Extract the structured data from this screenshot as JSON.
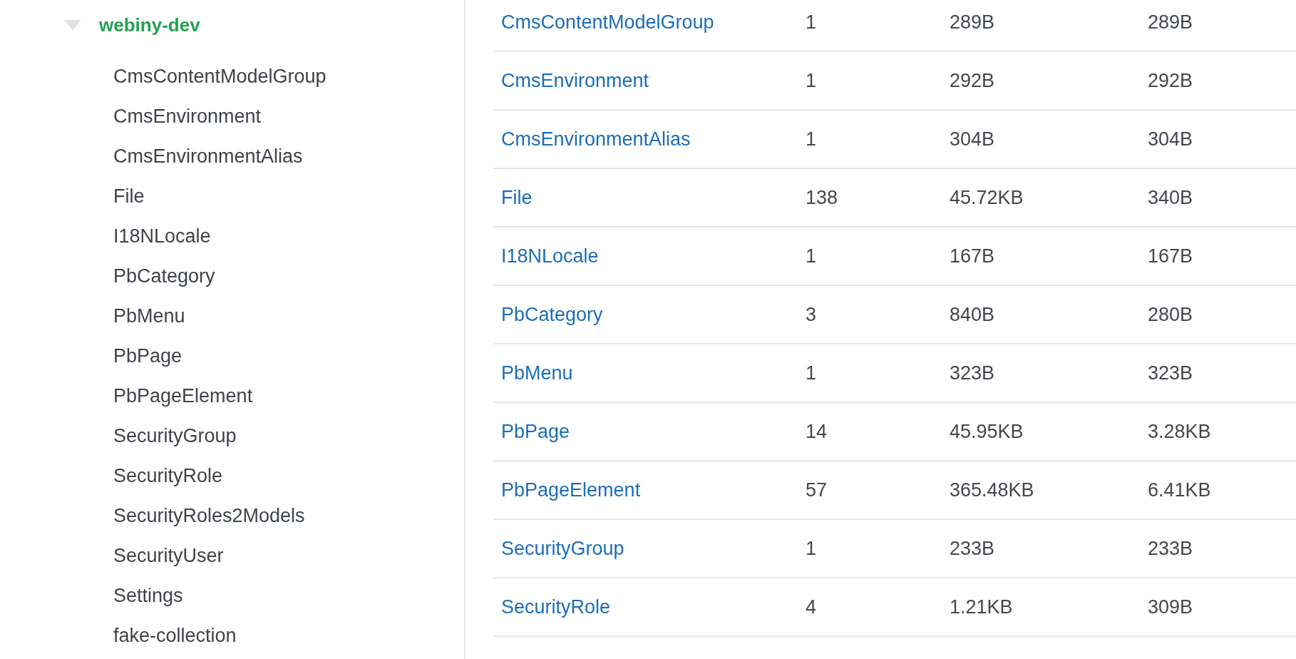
{
  "sidebar": {
    "database": {
      "name": "webiny-dev",
      "expanded": true
    },
    "collections": [
      "CmsContentModelGroup",
      "CmsEnvironment",
      "CmsEnvironmentAlias",
      "File",
      "I18NLocale",
      "PbCategory",
      "PbMenu",
      "PbPage",
      "PbPageElement",
      "SecurityGroup",
      "SecurityRole",
      "SecurityRoles2Models",
      "SecurityUser",
      "Settings",
      "fake-collection"
    ]
  },
  "table": {
    "rows": [
      {
        "collection": "CmsContentModelGroup",
        "cells": [
          "1",
          "289B",
          "289B"
        ]
      },
      {
        "collection": "CmsEnvironment",
        "cells": [
          "1",
          "292B",
          "292B"
        ]
      },
      {
        "collection": "CmsEnvironmentAlias",
        "cells": [
          "1",
          "304B",
          "304B"
        ]
      },
      {
        "collection": "File",
        "cells": [
          "138",
          "45.72KB",
          "340B"
        ]
      },
      {
        "collection": "I18NLocale",
        "cells": [
          "1",
          "167B",
          "167B"
        ]
      },
      {
        "collection": "PbCategory",
        "cells": [
          "3",
          "840B",
          "280B"
        ]
      },
      {
        "collection": "PbMenu",
        "cells": [
          "1",
          "323B",
          "323B"
        ]
      },
      {
        "collection": "PbPage",
        "cells": [
          "14",
          "45.95KB",
          "3.28KB"
        ]
      },
      {
        "collection": "PbPageElement",
        "cells": [
          "57",
          "365.48KB",
          "6.41KB"
        ]
      },
      {
        "collection": "SecurityGroup",
        "cells": [
          "1",
          "233B",
          "233B"
        ]
      },
      {
        "collection": "SecurityRole",
        "cells": [
          "4",
          "1.21KB",
          "309B"
        ]
      }
    ]
  }
}
